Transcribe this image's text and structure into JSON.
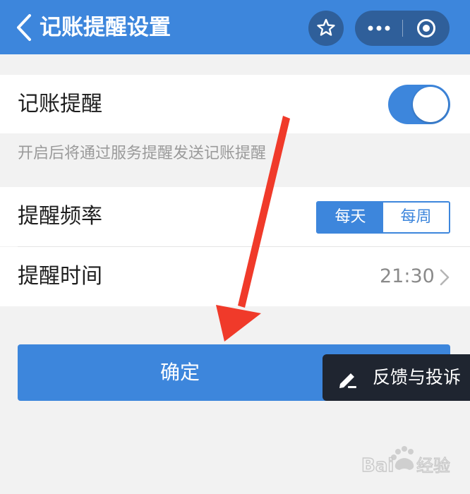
{
  "navbar": {
    "title": "记账提醒设置",
    "icons": {
      "back": "chevron-left-icon",
      "favorite": "star-icon",
      "more": "more-dots-icon",
      "close": "target-circle-icon"
    }
  },
  "remind": {
    "label": "记账提醒",
    "enabled": true,
    "hint": "开启后将通过服务提醒发送记账提醒"
  },
  "frequency": {
    "label": "提醒频率",
    "options": [
      "每天",
      "每周"
    ],
    "selected": "每天"
  },
  "time": {
    "label": "提醒时间",
    "value": "21:30"
  },
  "confirm": {
    "label": "确定"
  },
  "feedback": {
    "label": "反馈与投诉",
    "icon": "pencil-icon"
  },
  "colors": {
    "primary": "#3d86dc",
    "navbar_capsule": "#2f5f9a",
    "background": "#f2f2f2",
    "annotation_arrow": "#f03a2a",
    "feedback_bg": "#1f2530"
  }
}
